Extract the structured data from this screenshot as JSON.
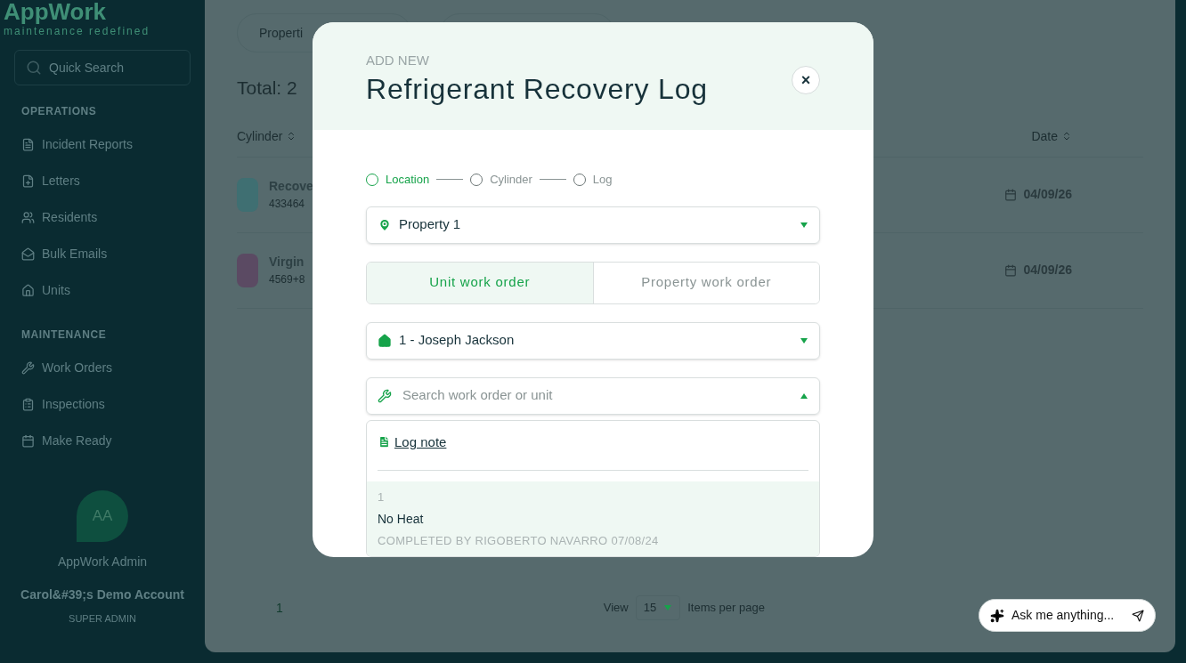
{
  "sidebar": {
    "logo": "AppWork",
    "tagline": "maintenance redefined",
    "search": {
      "placeholder": "Quick Search"
    },
    "sections": [
      {
        "title": "OPERATIONS",
        "items": [
          "Incident Reports",
          "Letters",
          "Residents",
          "Bulk Emails",
          "Units"
        ]
      },
      {
        "title": "MAINTENANCE",
        "items": [
          "Work Orders",
          "Inspections",
          "Make Ready"
        ]
      }
    ],
    "user": {
      "initials": "AA",
      "name": "AppWork Admin",
      "account": "Carol&#39;s Demo Account",
      "role": "SUPER ADMIN"
    }
  },
  "main": {
    "tabs": [
      {
        "label": "Properti"
      }
    ],
    "total": "Total: 2",
    "columns": [
      "Cylinder",
      "Date"
    ],
    "rows": [
      {
        "name": "Recove",
        "number": "433464",
        "date": "04/09/26",
        "color": "#3f6f72"
      },
      {
        "name": "Virgin",
        "number": "4569+8",
        "date": "04/09/26",
        "color": "#5b4a63"
      }
    ],
    "pagination": {
      "page": "1",
      "view": "View",
      "per_page": "15",
      "items_label": "Items per page"
    }
  },
  "modal": {
    "eyebrow": "ADD NEW",
    "title": "Refrigerant Recovery Log",
    "close": "×",
    "steps": [
      {
        "label": "Location",
        "selected": true
      },
      {
        "label": "Cylinder",
        "selected": false
      },
      {
        "label": "Log",
        "selected": false
      }
    ],
    "property_select": {
      "value": "Property 1"
    },
    "order_types": [
      {
        "label": "Unit work order",
        "selected": true
      },
      {
        "label": "Property work order",
        "selected": false
      }
    ],
    "unit_select": {
      "value": "1 - Joseph Jackson"
    },
    "work_order_search": {
      "placeholder": "Search work order or unit",
      "expanded": true
    },
    "dropdown": {
      "log_note": "Log note",
      "options": [
        {
          "number": "1",
          "title": "No Heat",
          "status": "COMPLETED BY RIGOBERTO NAVARRO 07/08/24",
          "selected": true
        }
      ]
    }
  },
  "chat": {
    "placeholder": "Ask me anything..."
  }
}
